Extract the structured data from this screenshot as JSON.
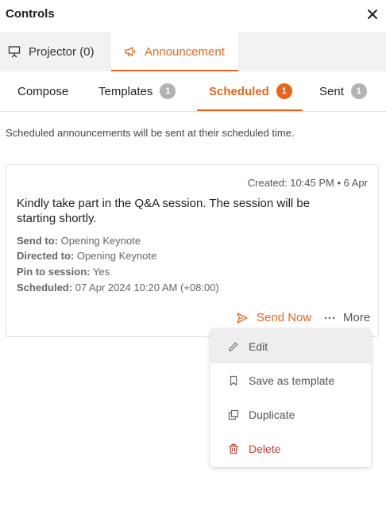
{
  "header": {
    "title": "Controls"
  },
  "main_tabs": {
    "projector": "Projector (0)",
    "announcement": "Announcement"
  },
  "sub_tabs": {
    "compose": "Compose",
    "templates": "Templates",
    "templates_count": "1",
    "scheduled": "Scheduled",
    "scheduled_count": "1",
    "sent": "Sent",
    "sent_count": "1"
  },
  "info_text": "Scheduled announcements will be sent at their scheduled time.",
  "card": {
    "created": "Created: 10:45 PM • 6 Apr",
    "message": "Kindly take part in the Q&A session. The session will be starting shortly.",
    "send_to_label": "Send to:",
    "send_to_value": "Opening Keynote",
    "directed_to_label": "Directed to:",
    "directed_to_value": "Opening Keynote",
    "pin_label": "Pin to session:",
    "pin_value": "Yes",
    "scheduled_label": "Scheduled:",
    "scheduled_value": "07 Apr 2024 10:20 AM (+08:00)",
    "send_now": "Send Now",
    "more": "More"
  },
  "menu": {
    "edit": "Edit",
    "save_template": "Save as template",
    "duplicate": "Duplicate",
    "delete": "Delete"
  },
  "colors": {
    "accent": "#e8651c",
    "danger": "#d33a2c",
    "badge_inactive": "#b3b3b3"
  },
  "icons": {
    "close": "close-icon",
    "projector": "projector-icon",
    "megaphone": "megaphone-icon",
    "send": "send-icon",
    "more": "ellipsis-icon",
    "edit": "pencil-icon",
    "save": "bookmark-icon",
    "duplicate": "copy-icon",
    "delete": "trash-icon"
  }
}
